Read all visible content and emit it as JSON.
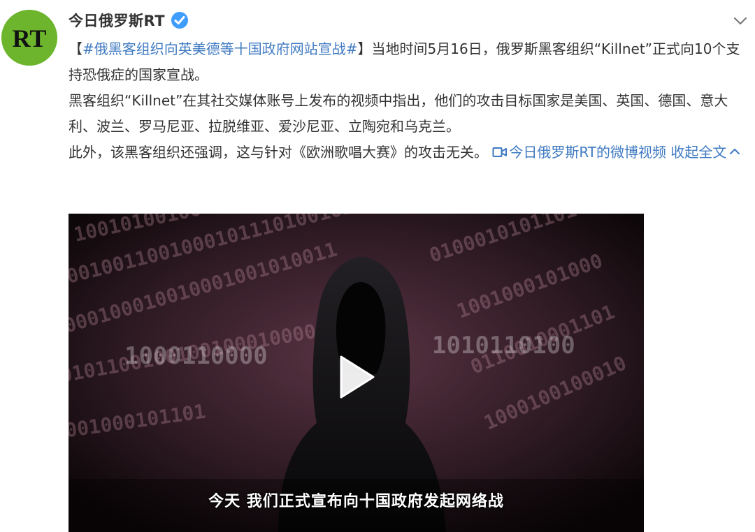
{
  "post": {
    "username": "今日俄罗斯RT",
    "avatar_text": "RT",
    "brand_color": "#6cb52d",
    "verified_color": "#3f9dfd",
    "link_color": "#3f7ac2",
    "icons": {
      "verified": "verified-badge-icon",
      "menu": "chevron-down-icon",
      "video_link": "video-link-icon",
      "collapse": "chevron-up-icon",
      "play": "play-icon"
    },
    "body": {
      "p1_open_bracket": "【",
      "topic": "#俄黑客组织向英美德等十国政府网站宣战#",
      "p1_text": "】当地时间5月16日，俄罗斯黑客组织“Killnet”正式向10个支持恐俄症的国家宣战。",
      "p2_text": "黑客组织“Killnet”在其社交媒体账号上发布的视频中指出，他们的攻击目标国家是美国、英国、德国、意大利、波兰、罗马尼亚、拉脱维亚、爱沙尼亚、立陶宛和乌克兰。",
      "p3_text": "此外，该黑客组织还强调，这与针对《欧洲歌唱大赛》的攻击无关。 ",
      "video_link_label": "今日俄罗斯RT的微博视频",
      "collapse_label": "收起全文"
    },
    "video": {
      "subtitle": "今天 我们正式宣布向十国政府发起网络战"
    }
  }
}
